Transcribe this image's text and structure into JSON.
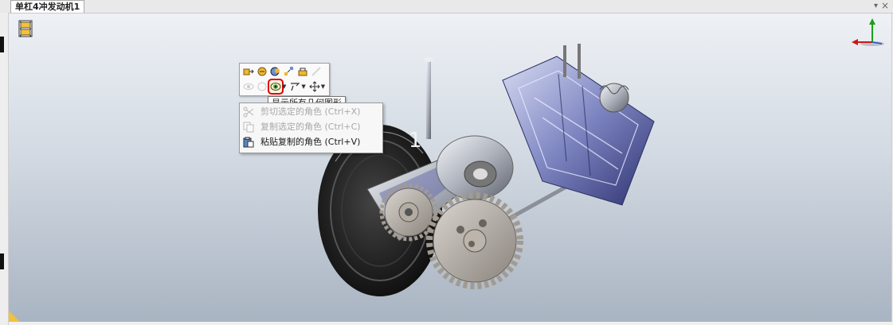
{
  "window": {
    "tab_title": "单杠4冲发动机1",
    "pin_icon": "pin-icon",
    "close_label": "×",
    "dropdown_label": "▾"
  },
  "viewport": {
    "background_top": "#eef1f5",
    "background_bottom": "#a9b4c2",
    "film_icon": "film-strip-icon",
    "axis_icon": "axis-triad-icon",
    "label_1": "1"
  },
  "mini_toolbar": {
    "row1": [
      "insert-actor-icon",
      "actor-transform-icon",
      "color-icon",
      "explode-icon",
      "pose-icon",
      "pen-icon"
    ],
    "row2": [
      "hide-icon",
      "ghost-icon",
      "show-all-geometry-icon",
      "camera-icon",
      "move-icon"
    ],
    "highlighted": "show-all-geometry-icon",
    "highlight_color": "#e00000"
  },
  "tooltip": {
    "text": "显示所有几何图形"
  },
  "context_menu": {
    "items": [
      {
        "label": "剪切选定的角色 (Ctrl+X)",
        "icon": "scissors-icon",
        "enabled": false
      },
      {
        "label": "复制选定的角色 (Ctrl+C)",
        "icon": "copy-icon",
        "enabled": false
      },
      {
        "label": "粘贴复制的角色 (Ctrl+V)",
        "icon": "paste-icon",
        "enabled": true
      }
    ]
  }
}
